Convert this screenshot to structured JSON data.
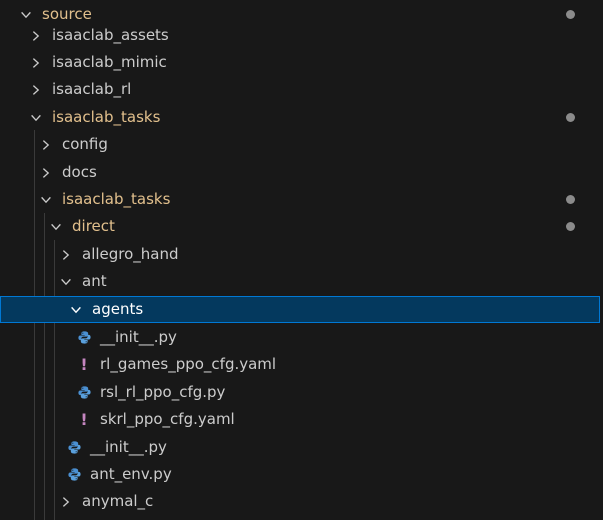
{
  "tree": {
    "source": "source",
    "isaaclab_assets": "isaaclab_assets",
    "isaaclab_mimic": "isaaclab_mimic",
    "isaaclab_rl": "isaaclab_rl",
    "isaaclab_tasks": "isaaclab_tasks",
    "config": "config",
    "docs": "docs",
    "isaaclab_tasks_inner": "isaaclab_tasks",
    "direct": "direct",
    "allegro_hand": "allegro_hand",
    "ant": "ant",
    "agents": "agents",
    "init_py_agents": "__init__.py",
    "rl_games": "rl_games_ppo_cfg.yaml",
    "rsl_rl": "rsl_rl_ppo_cfg.py",
    "skrl": "skrl_ppo_cfg.yaml",
    "init_py_ant": "__init__.py",
    "ant_env": "ant_env.py",
    "anymal_c": "anymal_c"
  },
  "icons": {
    "python": "python-file-icon",
    "yaml": "yaml-file-icon"
  },
  "colors": {
    "modified": "#e2c08d",
    "selection": "#04395e",
    "selection_border": "#0078d4"
  }
}
